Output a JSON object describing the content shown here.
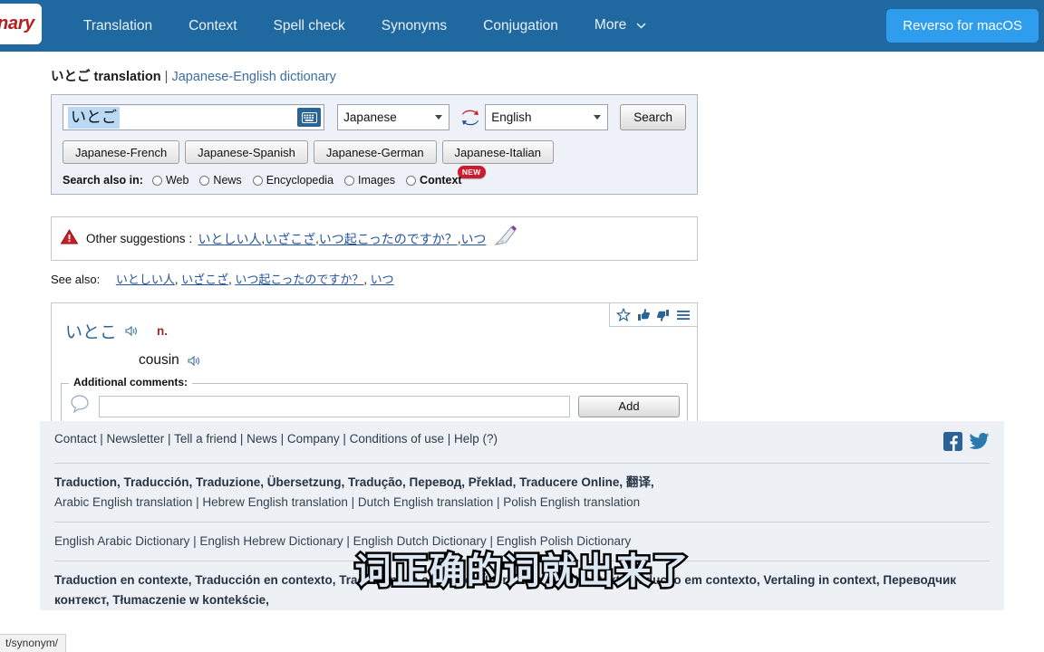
{
  "navbar": {
    "logo_text": "nary",
    "links": [
      {
        "label": "Translation",
        "name": "nav-translation"
      },
      {
        "label": "Context",
        "name": "nav-context"
      },
      {
        "label": "Spell check",
        "name": "nav-spell-check"
      },
      {
        "label": "Synonyms",
        "name": "nav-synonyms"
      },
      {
        "label": "Conjugation",
        "name": "nav-conjugation"
      },
      {
        "label": "More",
        "name": "nav-more",
        "caret": "⌄"
      }
    ],
    "cta_label": "Reverso for macOS",
    "bg_color": "#1f68a0",
    "cta_color": "#2f9ded"
  },
  "breadcrumb": {
    "keyword": "いとご",
    "title_suffix": " translation",
    "separator": " | ",
    "dictionary": "Japanese-English dictionary"
  },
  "search": {
    "query_value": "いとご",
    "placeholder": "",
    "keyboard_icon": "keyboard-icon",
    "source_language": "Japanese",
    "target_language": "English",
    "swap_icon": "swap-languages-icon",
    "search_button": "Search",
    "language_pairs": [
      "Japanese-French",
      "Japanese-Spanish",
      "Japanese-German",
      "Japanese-Italian"
    ],
    "search_also_label": "Search also in:",
    "search_also_options": [
      {
        "label": "Web",
        "bold": false,
        "badge": ""
      },
      {
        "label": "News",
        "bold": false,
        "badge": ""
      },
      {
        "label": "Encyclopedia",
        "bold": false,
        "badge": ""
      },
      {
        "label": "Images",
        "bold": false,
        "badge": ""
      },
      {
        "label": "Context",
        "bold": true,
        "badge": "NEW"
      }
    ]
  },
  "suggestions": {
    "warning_icon": "warning-triangle-icon",
    "label": "Other suggestions :",
    "items": [
      "いとしい人",
      "いざこざ",
      "いつ起こったのですか？",
      "いつ"
    ],
    "separator": ", ",
    "pencil_icon": "edit-pencil-icon"
  },
  "see_also": {
    "label": "See also:",
    "items": [
      "いとしい人",
      "いざこざ",
      "いつ起こったのですか？",
      "いつ"
    ]
  },
  "result": {
    "entry_word": "いとこ",
    "speaker_icon": "speaker-icon",
    "part_of_speech": "n.",
    "translation": "cousin",
    "translation_speaker_icon": "speaker-icon",
    "card_icons": [
      "favorite-star-icon",
      "thumbs-up-icon",
      "thumbs-down-icon",
      "menu-hamburger-icon"
    ],
    "comments_legend": "Additional comments:",
    "comment_icon": "comment-bubble-icon",
    "comment_value": "",
    "comment_placeholder": "",
    "add_button": "Add"
  },
  "footer": {
    "links": "Contact | Newsletter | Tell a friend | News | Company | Conditions of use | Help (?)",
    "social": [
      "facebook-icon",
      "twitter-icon"
    ],
    "row1_bold": "Traduction, Traducción, Traduzione, Übersetzung, Tradução, Перевод, Překlad, Traducere Online, 翻译,",
    "row2": "Arabic English translation | Hebrew English translation | Dutch English translation | Polish English translation",
    "row3": "English Arabic Dictionary | English Hebrew Dictionary | English Dutch Dictionary | English Polish Dictionary",
    "row4_bold": "Traduction en contexte, Traducción en contexto, Traduzione in contesto, Übersetzung im Kontext, Tradução em contexto, Vertaling in context, Переводчик",
    "row5_bold": "контекст, Tłumaczenie w kontekście,"
  },
  "subtitle": {
    "text": "词正确的词就出来了",
    "fill_color": "#dce9f5",
    "stroke_color": "#000000"
  },
  "statusbar": {
    "url": "t/synonym/"
  }
}
